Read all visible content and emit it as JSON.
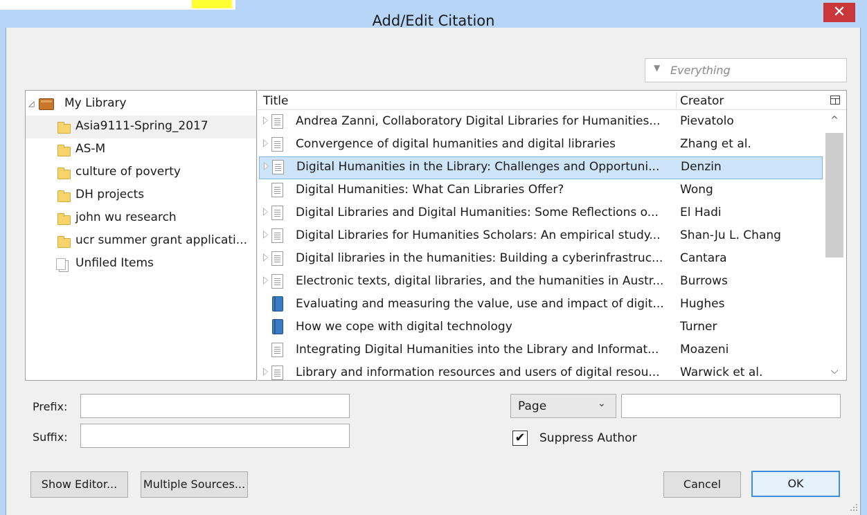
{
  "window": {
    "title": "Add/Edit Citation",
    "close_glyph": "✕"
  },
  "search": {
    "placeholder": "Everything",
    "dropdown_glyph": "▼"
  },
  "library": {
    "items": [
      {
        "label": "My Library",
        "icon": "library-icon",
        "expanded": true
      },
      {
        "label": "Asia9111-Spring_2017",
        "icon": "folder-icon",
        "selected": true
      },
      {
        "label": "AS-M",
        "icon": "folder-icon"
      },
      {
        "label": "culture of poverty",
        "icon": "folder-icon"
      },
      {
        "label": "DH projects",
        "icon": "folder-icon"
      },
      {
        "label": "john wu research",
        "icon": "folder-icon"
      },
      {
        "label": "ucr summer grant applicati...",
        "icon": "folder-icon"
      },
      {
        "label": "Unfiled Items",
        "icon": "unfiled-items-icon"
      }
    ],
    "expand_glyph": "◿"
  },
  "items_table": {
    "headers": {
      "title": "Title",
      "creator": "Creator"
    },
    "rows": [
      {
        "title": "Andrea Zanni, Collaboratory Digital Libraries for Humanities...",
        "creator": "Pievatolo",
        "icon": "document-icon",
        "has_children": true
      },
      {
        "title": "Convergence of digital humanities and digital libraries",
        "creator": "Zhang et al.",
        "icon": "document-icon",
        "has_children": true
      },
      {
        "title": "Digital Humanities in the Library: Challenges and Opportuni...",
        "creator": "Denzin",
        "icon": "document-icon",
        "has_children": true,
        "selected": true
      },
      {
        "title": "Digital Humanities: What Can Libraries Offer?",
        "creator": "Wong",
        "icon": "document-icon",
        "has_children": false
      },
      {
        "title": "Digital Libraries and Digital Humanities: Some Reflections o...",
        "creator": "El Hadi",
        "icon": "document-icon",
        "has_children": true
      },
      {
        "title": "Digital Libraries for Humanities Scholars: An empirical study...",
        "creator": "Shan-Ju L. Chang",
        "icon": "document-icon",
        "has_children": true
      },
      {
        "title": "Digital libraries in the humanities: Building a cyberinfrastruc...",
        "creator": "Cantara",
        "icon": "document-icon",
        "has_children": true
      },
      {
        "title": "Electronic texts, digital libraries, and the humanities in Austr...",
        "creator": "Burrows",
        "icon": "document-icon",
        "has_children": true
      },
      {
        "title": "Evaluating and measuring the value, use and impact of digit...",
        "creator": "Hughes",
        "icon": "book-icon",
        "has_children": false
      },
      {
        "title": "How we cope with digital technology",
        "creator": "Turner",
        "icon": "book-icon",
        "has_children": false
      },
      {
        "title": "Integrating Digital Humanities into the Library and Informat...",
        "creator": "Moazeni",
        "icon": "document-icon",
        "has_children": false
      },
      {
        "title": "Library and information resources and users of digital resou...",
        "creator": "Warwick et al.",
        "icon": "document-icon",
        "has_children": true
      }
    ],
    "scroll_up_glyph": "^",
    "scroll_down_glyph": "⌵"
  },
  "form": {
    "prefix_label": "Prefix:",
    "prefix_value": "",
    "suffix_label": "Suffix:",
    "suffix_value": "",
    "locator_type": "Page",
    "locator_chevron": "⌄",
    "locator_value": "",
    "suppress_author_label": "Suppress Author",
    "suppress_author_checked": true,
    "check_glyph": "✔"
  },
  "buttons": {
    "show_editor": "Show Editor...",
    "multiple_sources": "Multiple Sources...",
    "cancel": "Cancel",
    "ok": "OK"
  },
  "colors": {
    "titlebar": "#b6d5f7",
    "close": "#c9373a",
    "selection": "#cde4f9",
    "selection_border": "#7eb4ea",
    "ok_border": "#3d8ee0"
  }
}
